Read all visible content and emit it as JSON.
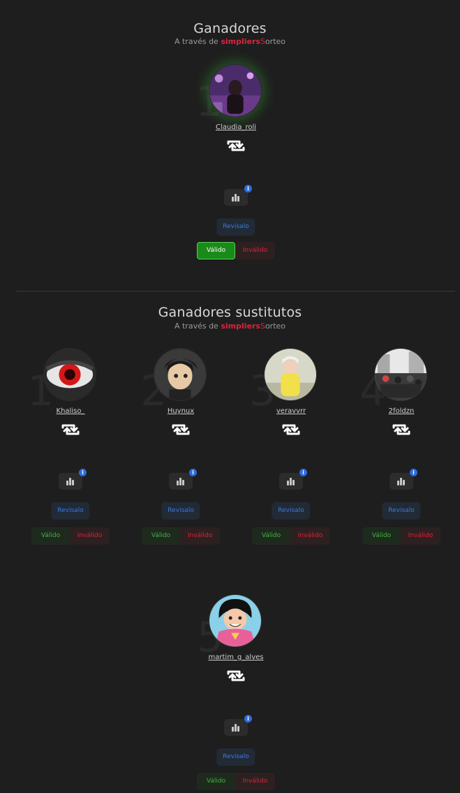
{
  "winners_section": {
    "title": "Ganadores",
    "subtitle_prefix": "A través de",
    "brand": "simpliers",
    "brand_s": "S",
    "brand_suffix": "orteo"
  },
  "substitutes_section": {
    "title": "Ganadores sustitutos",
    "subtitle_prefix": "A través de",
    "brand": "simpliers",
    "brand_s": "S",
    "brand_suffix": "orteo"
  },
  "labels": {
    "review": "Revisalo",
    "valid": "Válido",
    "invalid": "Inválido",
    "info": "i"
  },
  "winners": [
    {
      "rank": "1",
      "username": "Claudia_roli",
      "valid_selected": true
    }
  ],
  "substitutes": [
    {
      "rank": "1",
      "username": "Khaliso_"
    },
    {
      "rank": "2",
      "username": "Huynux"
    },
    {
      "rank": "3",
      "username": "veravvrr"
    },
    {
      "rank": "4",
      "username": "2foldzn"
    },
    {
      "rank": "5",
      "username": "martim_g_alves"
    }
  ],
  "colors": {
    "background": "#1e1e1e",
    "brand_red": "#e0223a",
    "valid_green": "#3db53d",
    "review_blue": "#3a7ae0"
  }
}
